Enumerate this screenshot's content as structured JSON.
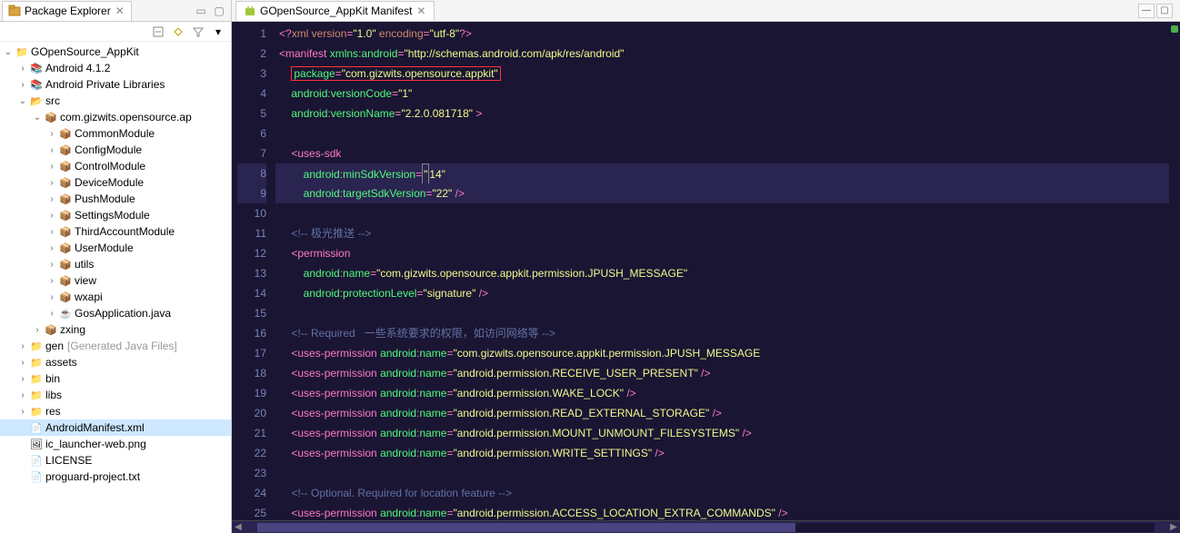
{
  "left_panel": {
    "title": "Package Explorer",
    "tree": [
      {
        "ind": 0,
        "tw": "v",
        "icon": "proj",
        "label": "GOpenSource_AppKit"
      },
      {
        "ind": 1,
        "tw": ">",
        "icon": "lib",
        "label": "Android 4.1.2"
      },
      {
        "ind": 1,
        "tw": ">",
        "icon": "lib",
        "label": "Android Private Libraries"
      },
      {
        "ind": 1,
        "tw": "v",
        "icon": "src",
        "label": "src"
      },
      {
        "ind": 2,
        "tw": "v",
        "icon": "pkg",
        "label": "com.gizwits.opensource.ap"
      },
      {
        "ind": 3,
        "tw": ">",
        "icon": "pkg",
        "label": "CommonModule"
      },
      {
        "ind": 3,
        "tw": ">",
        "icon": "pkg",
        "label": "ConfigModule"
      },
      {
        "ind": 3,
        "tw": ">",
        "icon": "pkg",
        "label": "ControlModule"
      },
      {
        "ind": 3,
        "tw": ">",
        "icon": "pkg",
        "label": "DeviceModule"
      },
      {
        "ind": 3,
        "tw": ">",
        "icon": "pkg",
        "label": "PushModule"
      },
      {
        "ind": 3,
        "tw": ">",
        "icon": "pkg",
        "label": "SettingsModule"
      },
      {
        "ind": 3,
        "tw": ">",
        "icon": "pkg",
        "label": "ThirdAccountModule"
      },
      {
        "ind": 3,
        "tw": ">",
        "icon": "pkg",
        "label": "UserModule"
      },
      {
        "ind": 3,
        "tw": ">",
        "icon": "pkg",
        "label": "utils"
      },
      {
        "ind": 3,
        "tw": ">",
        "icon": "pkg",
        "label": "view"
      },
      {
        "ind": 3,
        "tw": ">",
        "icon": "pkg",
        "label": "wxapi"
      },
      {
        "ind": 3,
        "tw": ">",
        "icon": "java",
        "label": "GosApplication.java"
      },
      {
        "ind": 2,
        "tw": ">",
        "icon": "pkg",
        "label": "zxing"
      },
      {
        "ind": 1,
        "tw": ">",
        "icon": "fldr",
        "label": "gen",
        "decor": " [Generated Java Files]"
      },
      {
        "ind": 1,
        "tw": ">",
        "icon": "fldr",
        "label": "assets"
      },
      {
        "ind": 1,
        "tw": ">",
        "icon": "fldr",
        "label": "bin"
      },
      {
        "ind": 1,
        "tw": ">",
        "icon": "fldr",
        "label": "libs"
      },
      {
        "ind": 1,
        "tw": ">",
        "icon": "fldr",
        "label": "res"
      },
      {
        "ind": 1,
        "tw": "",
        "icon": "xml",
        "label": "AndroidManifest.xml",
        "sel": true
      },
      {
        "ind": 1,
        "tw": "",
        "icon": "img",
        "label": "ic_launcher-web.png"
      },
      {
        "ind": 1,
        "tw": "",
        "icon": "file",
        "label": "LICENSE"
      },
      {
        "ind": 1,
        "tw": "",
        "icon": "file",
        "label": "proguard-project.txt"
      }
    ]
  },
  "editor": {
    "tab_title": "GOpenSource_AppKit Manifest",
    "lines": [
      {
        "n": 1,
        "seg": [
          [
            "t-punc",
            "<?"
          ],
          [
            "t-pi",
            "xml version"
          ],
          [
            "t-eq",
            "="
          ],
          [
            "t-str",
            "\"1.0\""
          ],
          [
            "t-pi",
            " encoding"
          ],
          [
            "t-eq",
            "="
          ],
          [
            "t-str",
            "\"utf-8\""
          ],
          [
            "t-punc",
            "?>"
          ]
        ]
      },
      {
        "n": 2,
        "seg": [
          [
            "t-punc",
            "<"
          ],
          [
            "t-tag",
            "manifest"
          ],
          [
            "t-txt",
            " "
          ],
          [
            "t-attr",
            "xmlns"
          ],
          [
            "t-colon",
            ":"
          ],
          [
            "t-attr",
            "android"
          ],
          [
            "t-eq",
            "="
          ],
          [
            "t-str",
            "\"http://schemas.android.com/apk/res/android\""
          ]
        ]
      },
      {
        "n": 3,
        "seg": [
          [
            "t-txt",
            "    "
          ],
          [
            "red-box",
            [
              [
                "t-attr",
                "package"
              ],
              [
                "t-eq",
                "="
              ],
              [
                "t-str",
                "\"com.gizwits.opensource.appkit\""
              ]
            ]
          ]
        ]
      },
      {
        "n": 4,
        "seg": [
          [
            "t-txt",
            "    "
          ],
          [
            "t-attr",
            "android"
          ],
          [
            "t-colon",
            ":"
          ],
          [
            "t-attr",
            "versionCode"
          ],
          [
            "t-eq",
            "="
          ],
          [
            "t-str",
            "\"1\""
          ]
        ]
      },
      {
        "n": 5,
        "seg": [
          [
            "t-txt",
            "    "
          ],
          [
            "t-attr",
            "android"
          ],
          [
            "t-colon",
            ":"
          ],
          [
            "t-attr",
            "versionName"
          ],
          [
            "t-eq",
            "="
          ],
          [
            "t-str",
            "\"2.2.0.081718\""
          ],
          [
            "t-txt",
            " "
          ],
          [
            "t-punc",
            ">"
          ]
        ]
      },
      {
        "n": 6,
        "seg": [
          [
            "t-txt",
            ""
          ]
        ]
      },
      {
        "n": 7,
        "seg": [
          [
            "t-txt",
            "    "
          ],
          [
            "t-punc",
            "<"
          ],
          [
            "t-tag",
            "uses-sdk"
          ]
        ]
      },
      {
        "n": 8,
        "hl": true,
        "seg": [
          [
            "t-txt",
            "        "
          ],
          [
            "t-attr",
            "android"
          ],
          [
            "t-colon",
            ":"
          ],
          [
            "t-attr",
            "minSdkVersion"
          ],
          [
            "t-eq",
            "="
          ],
          [
            "cursor-box",
            [
              [
                "t-str",
                "\""
              ]
            ]
          ],
          [
            "t-str",
            "14\""
          ]
        ]
      },
      {
        "n": 9,
        "hl": true,
        "seg": [
          [
            "t-txt",
            "        "
          ],
          [
            "t-attr",
            "android"
          ],
          [
            "t-colon",
            ":"
          ],
          [
            "t-attr",
            "targetSdkVersion"
          ],
          [
            "t-eq",
            "="
          ],
          [
            "t-str",
            "\"22\""
          ],
          [
            "t-txt",
            " "
          ],
          [
            "t-punc",
            "/>"
          ]
        ]
      },
      {
        "n": 10,
        "seg": [
          [
            "t-txt",
            ""
          ]
        ]
      },
      {
        "n": 11,
        "seg": [
          [
            "t-txt",
            "    "
          ],
          [
            "t-cmt",
            "<!-- 极光推送 -->"
          ]
        ]
      },
      {
        "n": 12,
        "seg": [
          [
            "t-txt",
            "    "
          ],
          [
            "t-punc",
            "<"
          ],
          [
            "t-tag",
            "permission"
          ]
        ]
      },
      {
        "n": 13,
        "seg": [
          [
            "t-txt",
            "        "
          ],
          [
            "t-attr",
            "android"
          ],
          [
            "t-colon",
            ":"
          ],
          [
            "t-attr",
            "name"
          ],
          [
            "t-eq",
            "="
          ],
          [
            "t-str",
            "\"com.gizwits.opensource.appkit.permission.JPUSH_MESSAGE\""
          ]
        ]
      },
      {
        "n": 14,
        "seg": [
          [
            "t-txt",
            "        "
          ],
          [
            "t-attr",
            "android"
          ],
          [
            "t-colon",
            ":"
          ],
          [
            "t-attr",
            "protectionLevel"
          ],
          [
            "t-eq",
            "="
          ],
          [
            "t-str",
            "\"signature\""
          ],
          [
            "t-txt",
            " "
          ],
          [
            "t-punc",
            "/>"
          ]
        ]
      },
      {
        "n": 15,
        "seg": [
          [
            "t-txt",
            ""
          ]
        ]
      },
      {
        "n": 16,
        "seg": [
          [
            "t-txt",
            "    "
          ],
          [
            "t-cmt",
            "<!-- Required   一些系统要求的权限，如访问网络等 -->"
          ]
        ]
      },
      {
        "n": 17,
        "seg": [
          [
            "t-txt",
            "    "
          ],
          [
            "t-punc",
            "<"
          ],
          [
            "t-tag",
            "uses-permission"
          ],
          [
            "t-txt",
            " "
          ],
          [
            "t-attr",
            "android"
          ],
          [
            "t-colon",
            ":"
          ],
          [
            "t-attr",
            "name"
          ],
          [
            "t-eq",
            "="
          ],
          [
            "t-str",
            "\"com.gizwits.opensource.appkit.permission.JPUSH_MESSAGE"
          ]
        ]
      },
      {
        "n": 18,
        "seg": [
          [
            "t-txt",
            "    "
          ],
          [
            "t-punc",
            "<"
          ],
          [
            "t-tag",
            "uses-permission"
          ],
          [
            "t-txt",
            " "
          ],
          [
            "t-attr",
            "android"
          ],
          [
            "t-colon",
            ":"
          ],
          [
            "t-attr",
            "name"
          ],
          [
            "t-eq",
            "="
          ],
          [
            "t-str",
            "\"android.permission.RECEIVE_USER_PRESENT\""
          ],
          [
            "t-txt",
            " "
          ],
          [
            "t-punc",
            "/>"
          ]
        ]
      },
      {
        "n": 19,
        "seg": [
          [
            "t-txt",
            "    "
          ],
          [
            "t-punc",
            "<"
          ],
          [
            "t-tag",
            "uses-permission"
          ],
          [
            "t-txt",
            " "
          ],
          [
            "t-attr",
            "android"
          ],
          [
            "t-colon",
            ":"
          ],
          [
            "t-attr",
            "name"
          ],
          [
            "t-eq",
            "="
          ],
          [
            "t-str",
            "\"android.permission.WAKE_LOCK\""
          ],
          [
            "t-txt",
            " "
          ],
          [
            "t-punc",
            "/>"
          ]
        ]
      },
      {
        "n": 20,
        "seg": [
          [
            "t-txt",
            "    "
          ],
          [
            "t-punc",
            "<"
          ],
          [
            "t-tag",
            "uses-permission"
          ],
          [
            "t-txt",
            " "
          ],
          [
            "t-attr",
            "android"
          ],
          [
            "t-colon",
            ":"
          ],
          [
            "t-attr",
            "name"
          ],
          [
            "t-eq",
            "="
          ],
          [
            "t-str",
            "\"android.permission.READ_EXTERNAL_STORAGE\""
          ],
          [
            "t-txt",
            " "
          ],
          [
            "t-punc",
            "/>"
          ]
        ]
      },
      {
        "n": 21,
        "seg": [
          [
            "t-txt",
            "    "
          ],
          [
            "t-punc",
            "<"
          ],
          [
            "t-tag",
            "uses-permission"
          ],
          [
            "t-txt",
            " "
          ],
          [
            "t-attr",
            "android"
          ],
          [
            "t-colon",
            ":"
          ],
          [
            "t-attr",
            "name"
          ],
          [
            "t-eq",
            "="
          ],
          [
            "t-str",
            "\"android.permission.MOUNT_UNMOUNT_FILESYSTEMS\""
          ],
          [
            "t-txt",
            " "
          ],
          [
            "t-punc",
            "/>"
          ]
        ]
      },
      {
        "n": 22,
        "seg": [
          [
            "t-txt",
            "    "
          ],
          [
            "t-punc",
            "<"
          ],
          [
            "t-tag",
            "uses-permission"
          ],
          [
            "t-txt",
            " "
          ],
          [
            "t-attr",
            "android"
          ],
          [
            "t-colon",
            ":"
          ],
          [
            "t-attr",
            "name"
          ],
          [
            "t-eq",
            "="
          ],
          [
            "t-str",
            "\"android.permission.WRITE_SETTINGS\""
          ],
          [
            "t-txt",
            " "
          ],
          [
            "t-punc",
            "/>"
          ]
        ]
      },
      {
        "n": 23,
        "seg": [
          [
            "t-txt",
            ""
          ]
        ]
      },
      {
        "n": 24,
        "seg": [
          [
            "t-txt",
            "    "
          ],
          [
            "t-cmt",
            "<!-- Optional. Required for location feature -->"
          ]
        ]
      },
      {
        "n": 25,
        "seg": [
          [
            "t-txt",
            "    "
          ],
          [
            "t-punc",
            "<"
          ],
          [
            "t-tag",
            "uses-permission"
          ],
          [
            "t-txt",
            " "
          ],
          [
            "t-attr",
            "android"
          ],
          [
            "t-colon",
            ":"
          ],
          [
            "t-attr",
            "name"
          ],
          [
            "t-eq",
            "="
          ],
          [
            "t-str",
            "\"android.permission.ACCESS_LOCATION_EXTRA_COMMANDS\""
          ],
          [
            "t-txt",
            " "
          ],
          [
            "t-punc",
            "/>"
          ]
        ]
      }
    ]
  },
  "icons": {
    "proj": "📁",
    "lib": "📚",
    "src": "📂",
    "pkg": "📦",
    "java": "☕",
    "fldr": "📁",
    "xml": "📄",
    "img": "🖼",
    "file": "📄"
  }
}
